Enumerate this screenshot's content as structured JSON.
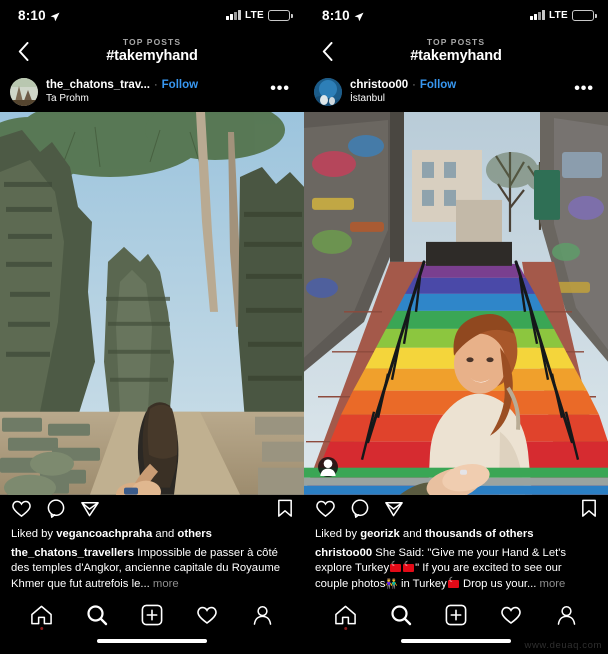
{
  "status_bar": {
    "time": "8:10",
    "location_icon": "location-arrow-icon",
    "network": "LTE",
    "signal_icon": "signal-bars-icon",
    "battery_icon": "battery-low-icon",
    "battery_level_pct": 28
  },
  "nav_header": {
    "back_icon": "chevron-left-icon",
    "top_label": "TOP POSTS",
    "hashtag": "#takemyhand"
  },
  "colors": {
    "background": "#000000",
    "link_blue": "#3897f0",
    "muted_gray": "#8e8e8e",
    "text_white": "#ffffff",
    "notification_red": "#8b1a1a"
  },
  "actions": {
    "like_icon": "heart-icon",
    "comment_icon": "comment-bubble-icon",
    "share_icon": "paper-plane-icon",
    "save_icon": "bookmark-icon"
  },
  "bottom_nav": {
    "items": [
      {
        "name": "home",
        "icon": "home-icon",
        "has_badge": true
      },
      {
        "name": "search",
        "icon": "search-icon",
        "has_badge": false
      },
      {
        "name": "create",
        "icon": "plus-square-icon",
        "has_badge": false
      },
      {
        "name": "activity",
        "icon": "heart-icon",
        "has_badge": false
      },
      {
        "name": "profile",
        "icon": "person-icon",
        "has_badge": false
      }
    ]
  },
  "watermark": "www.deuaq.com",
  "posts": [
    {
      "username": "the_chatons_trav...",
      "follow_label": "Follow",
      "separator": "·",
      "location": "Ta Prohm",
      "menu_icon": "more-options-icon",
      "avatar_icon": "user-avatar",
      "has_tag_badge": false,
      "likes_prefix": "Liked by",
      "likes_user": "vegancoachpraha",
      "likes_middle": "and",
      "likes_suffix": "others",
      "caption_author": "the_chatons_travellers",
      "caption_text": "Impossible de passer à côté des temples d'Angkor, ancienne capitale du Royaume Khmer que fut autrefois le...",
      "caption_more": "more"
    },
    {
      "username": "christoo00",
      "follow_label": "Follow",
      "separator": "·",
      "location": "İstanbul",
      "menu_icon": "more-options-icon",
      "avatar_icon": "user-avatar",
      "has_tag_badge": true,
      "tag_badge_icon": "tagged-person-icon",
      "likes_prefix": "Liked by",
      "likes_user": "georizk",
      "likes_middle": "and",
      "likes_suffix": "thousands of others",
      "caption_author": "christoo00",
      "caption_text_1": "She Said: \"Give me your Hand & Let's explore Turkey",
      "caption_text_2": "\" If you are excited to see our couple photos",
      "caption_text_3": "in Turkey",
      "caption_text_4": "Drop us your...",
      "caption_more": "more"
    }
  ]
}
